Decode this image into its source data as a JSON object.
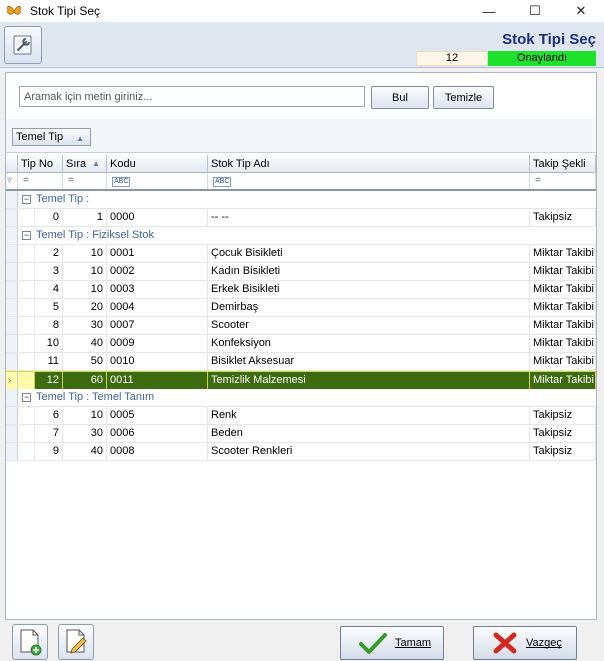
{
  "window": {
    "title": "Stok Tipi Seç",
    "minimize_glyph": "—",
    "maximize_glyph": "☐",
    "close_glyph": "✕"
  },
  "header": {
    "title": "Stok Tipi Seç",
    "selected_number": "12",
    "status": "Onaylandı",
    "status_color": "#1ee12c"
  },
  "search": {
    "placeholder": "Aramak için metin giriniz...",
    "find_label": "Bul",
    "clear_label": "Temizle"
  },
  "group_by": {
    "field": "Temel Tip"
  },
  "grid": {
    "columns": {
      "tip_no": "Tip No",
      "sira": "Sıra",
      "kodu": "Kodu",
      "ad": "Stok Tip Adı",
      "takip": "Takip Şekli"
    },
    "filter": {
      "eq": "=",
      "abc": "ABC"
    },
    "groups": [
      {
        "label": "Temel Tip :",
        "rows": [
          {
            "tip_no": "0",
            "sira": "1",
            "kodu": "0000",
            "ad": "-- --",
            "takip": "Takipsiz"
          }
        ]
      },
      {
        "label": "Temel Tip : Fiziksel Stok",
        "rows": [
          {
            "tip_no": "2",
            "sira": "10",
            "kodu": "0001",
            "ad": "Çocuk Bisikleti",
            "takip": "Miktar Takibi"
          },
          {
            "tip_no": "3",
            "sira": "10",
            "kodu": "0002",
            "ad": "Kadın Bisikleti",
            "takip": "Miktar Takibi"
          },
          {
            "tip_no": "4",
            "sira": "10",
            "kodu": "0003",
            "ad": "Erkek  Bisikleti",
            "takip": "Miktar Takibi"
          },
          {
            "tip_no": "5",
            "sira": "20",
            "kodu": "0004",
            "ad": "Demirbaş",
            "takip": "Miktar Takibi"
          },
          {
            "tip_no": "8",
            "sira": "30",
            "kodu": "0007",
            "ad": "Scooter",
            "takip": "Miktar Takibi"
          },
          {
            "tip_no": "10",
            "sira": "40",
            "kodu": "0009",
            "ad": "Konfeksiyon",
            "takip": "Miktar Takibi"
          },
          {
            "tip_no": "11",
            "sira": "50",
            "kodu": "0010",
            "ad": "Bisiklet Aksesuar",
            "takip": "Miktar Takibi"
          },
          {
            "tip_no": "12",
            "sira": "60",
            "kodu": "0011",
            "ad": "Temizlik Malzemesi",
            "takip": "Miktar Takibi",
            "selected": true
          }
        ]
      },
      {
        "label": "Temel Tip : Temel Tanım",
        "rows": [
          {
            "tip_no": "6",
            "sira": "10",
            "kodu": "0005",
            "ad": "Renk",
            "takip": "Takipsiz"
          },
          {
            "tip_no": "7",
            "sira": "30",
            "kodu": "0006",
            "ad": "Beden",
            "takip": "Takipsiz"
          },
          {
            "tip_no": "9",
            "sira": "40",
            "kodu": "0008",
            "ad": "Scooter Renkleri",
            "takip": "Takipsiz"
          }
        ]
      }
    ]
  },
  "footer": {
    "ok_label": "Tamam",
    "cancel_label": "Vazgeç"
  }
}
